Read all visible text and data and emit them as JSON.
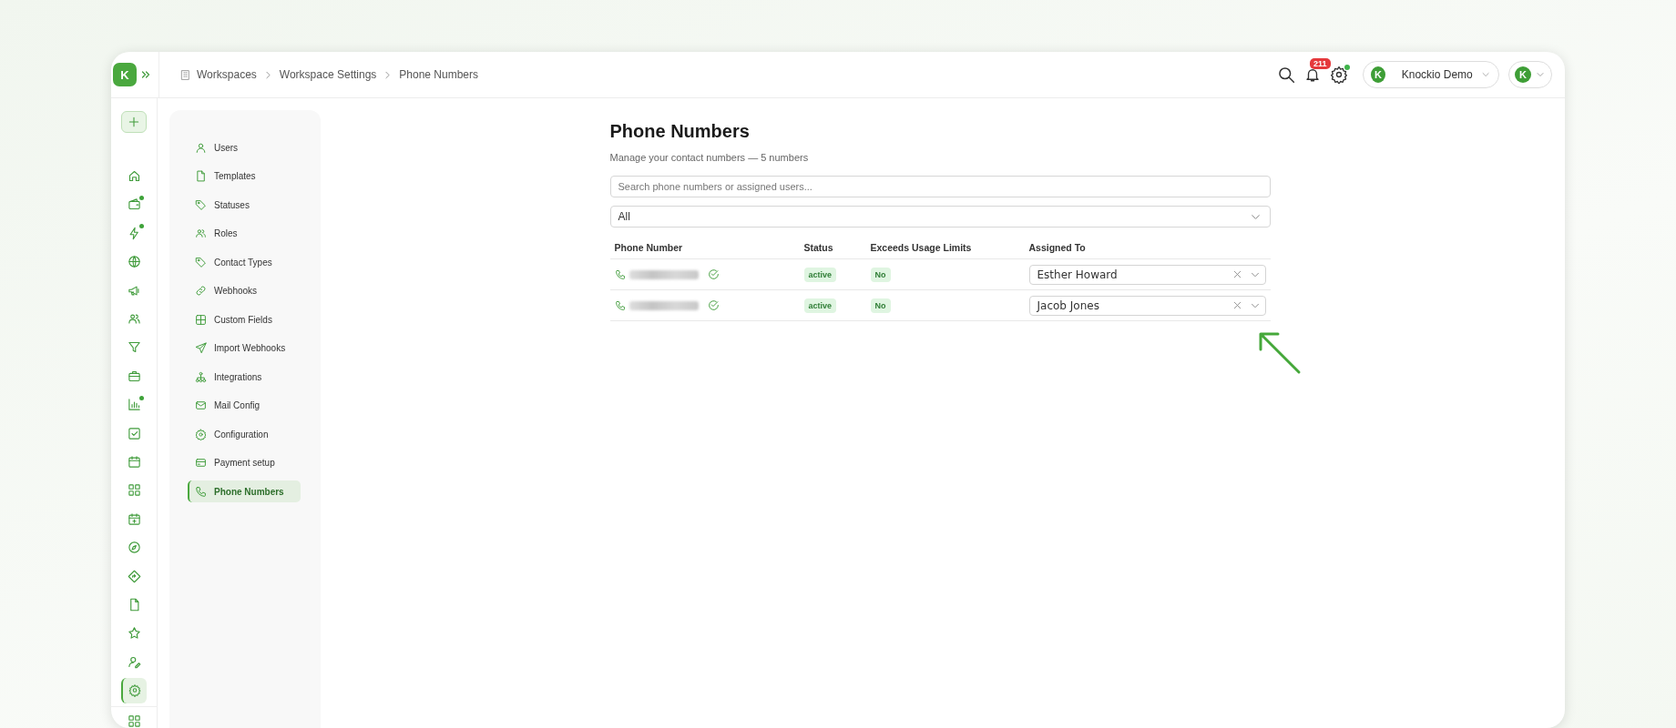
{
  "brand": {
    "mark": "K"
  },
  "breadcrumb": [
    "Workspaces",
    "Workspace Settings",
    "Phone Numbers"
  ],
  "header": {
    "notifications_count": "211",
    "settings_dot": true,
    "workspace": {
      "mark": "K",
      "name": "Knockio Demo"
    },
    "account": {
      "mark": "K"
    }
  },
  "rail": {
    "items": [
      {
        "kind": "home",
        "dot": false,
        "selected": false
      },
      {
        "kind": "wallet",
        "dot": true,
        "selected": false
      },
      {
        "kind": "bolt",
        "dot": true,
        "selected": false
      },
      {
        "kind": "globe",
        "dot": false,
        "selected": false
      },
      {
        "kind": "megaphone",
        "dot": false,
        "selected": false
      },
      {
        "kind": "users",
        "dot": false,
        "selected": false
      },
      {
        "kind": "filter",
        "dot": false,
        "selected": false
      },
      {
        "kind": "briefcase",
        "dot": false,
        "selected": false
      },
      {
        "kind": "chart",
        "dot": true,
        "selected": false
      },
      {
        "kind": "checkbox",
        "dot": false,
        "selected": false
      },
      {
        "kind": "calendar",
        "dot": false,
        "selected": false
      },
      {
        "kind": "grid",
        "dot": false,
        "selected": false
      },
      {
        "kind": "calendar-plus",
        "dot": false,
        "selected": false
      },
      {
        "kind": "compass",
        "dot": false,
        "selected": false
      },
      {
        "kind": "diamond",
        "dot": false,
        "selected": false
      },
      {
        "kind": "file",
        "dot": false,
        "selected": false
      },
      {
        "kind": "star",
        "dot": false,
        "selected": false
      },
      {
        "kind": "user-edit",
        "dot": false,
        "selected": false
      },
      {
        "kind": "gear",
        "dot": false,
        "selected": true
      }
    ]
  },
  "settings_menu": [
    {
      "kind": "user",
      "label": "Users",
      "selected": false
    },
    {
      "kind": "file",
      "label": "Templates",
      "selected": false
    },
    {
      "kind": "tag",
      "label": "Statuses",
      "selected": false
    },
    {
      "kind": "users",
      "label": "Roles",
      "selected": false
    },
    {
      "kind": "tag",
      "label": "Contact Types",
      "selected": false
    },
    {
      "kind": "link",
      "label": "Webhooks",
      "selected": false
    },
    {
      "kind": "table",
      "label": "Custom Fields",
      "selected": false
    },
    {
      "kind": "send",
      "label": "Import Webhooks",
      "selected": false
    },
    {
      "kind": "network",
      "label": "Integrations",
      "selected": false
    },
    {
      "kind": "mail",
      "label": "Mail Config",
      "selected": false
    },
    {
      "kind": "gear",
      "label": "Configuration",
      "selected": false
    },
    {
      "kind": "card",
      "label": "Payment setup",
      "selected": false
    },
    {
      "kind": "phone",
      "label": "Phone Numbers",
      "selected": true
    }
  ],
  "page": {
    "title": "Phone Numbers",
    "subtitle": "Manage your contact numbers — 5 numbers",
    "search": {
      "placeholder": "Search phone numbers or assigned users..."
    },
    "filter": {
      "value": "All"
    }
  },
  "table": {
    "columns": [
      "Phone Number",
      "Status",
      "Exceeds Usage Limits",
      "Assigned To"
    ],
    "rows": [
      {
        "status": "active",
        "exceeds": "No",
        "assigned_to": "Esther Howard"
      },
      {
        "status": "active",
        "exceeds": "No",
        "assigned_to": "Jacob Jones"
      }
    ]
  }
}
